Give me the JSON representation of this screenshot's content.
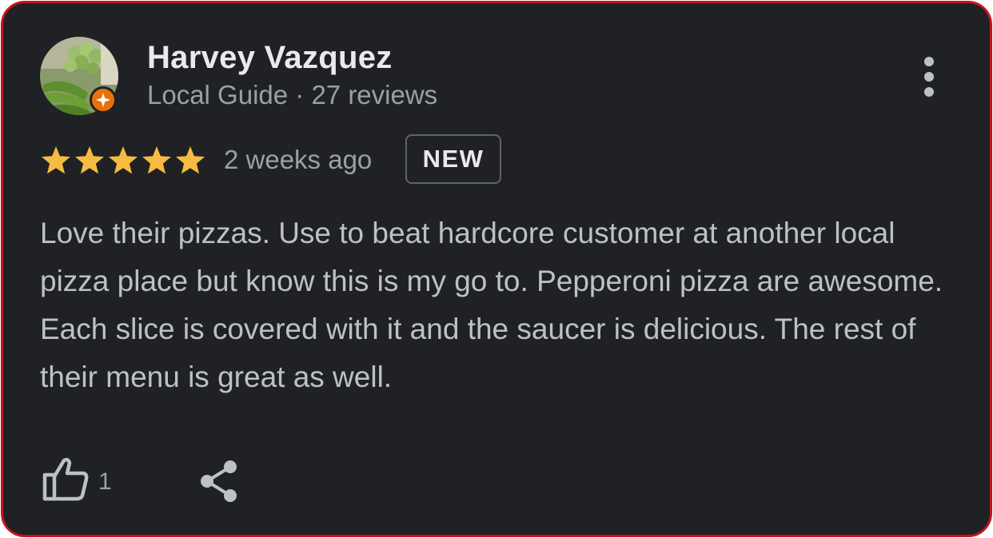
{
  "review": {
    "author": "Harvey Vazquez",
    "author_meta": "Local Guide · 27 reviews",
    "rating": 5,
    "max_rating": 5,
    "time": "2 weeks ago",
    "badge": "NEW",
    "text": "Love their pizzas. Use to beat hardcore customer at another local pizza place but know this is my go to. Pepperoni pizza are awesome. Each slice is covered with it and the saucer is delicious. The rest of their menu is great as well.",
    "like_count": "1"
  },
  "icons": {
    "more": "more-vert-icon",
    "like": "thumbs-up-icon",
    "share": "share-icon",
    "local_guide": "local-guide-badge-icon"
  },
  "colors": {
    "background": "#202124",
    "border": "#c4161c",
    "star": "#f6bb42",
    "badge": "#e8710a"
  }
}
